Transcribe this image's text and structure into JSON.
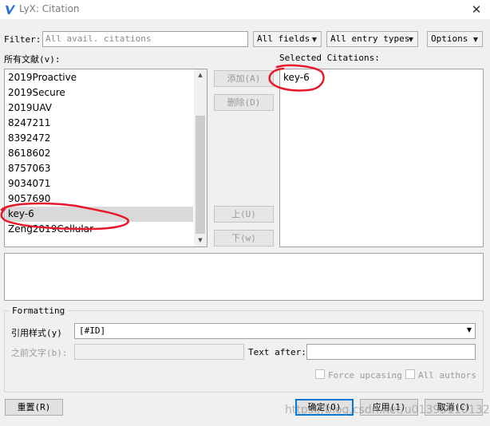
{
  "window": {
    "title": "LyX: Citation",
    "close_glyph": "✕"
  },
  "filter": {
    "label": "Filter:",
    "placeholder": "All avail. citations",
    "fields_combo": "All fields",
    "entry_types_combo": "All entry types",
    "options_button": "Options"
  },
  "available": {
    "label": "所有文献(v):",
    "items": [
      "2019Proactive",
      "2019Secure",
      "2019UAV",
      "8247211",
      "8392472",
      "8618602",
      "8757063",
      "9034071",
      "9057690",
      "key-6",
      "Zeng2019Cellular"
    ],
    "selected_item": "key-6"
  },
  "buttons": {
    "add": "添加(A)",
    "delete": "删除(D)",
    "up": "上(U)",
    "down": "下(w)"
  },
  "selected": {
    "label": "Selected Citations:",
    "items": [
      "key-6"
    ]
  },
  "formatting": {
    "legend": "Formatting",
    "style_label": "引用样式(y)",
    "style_value": "[#ID]",
    "text_before_label": "之前文字(b):",
    "text_after_label": "Text after:",
    "force_upcasing": "Force upcasing",
    "all_authors": "All authors"
  },
  "footer": {
    "reset": "重置(R)",
    "ok": "确定(O)",
    "apply": "应用(1)",
    "cancel": "取消(C)"
  },
  "watermark": "https://blog.csdn.net/u013951101328",
  "colors": {
    "annotation": "#e8182a",
    "accent": "#0078d7",
    "logo": "#2b6fd6"
  }
}
